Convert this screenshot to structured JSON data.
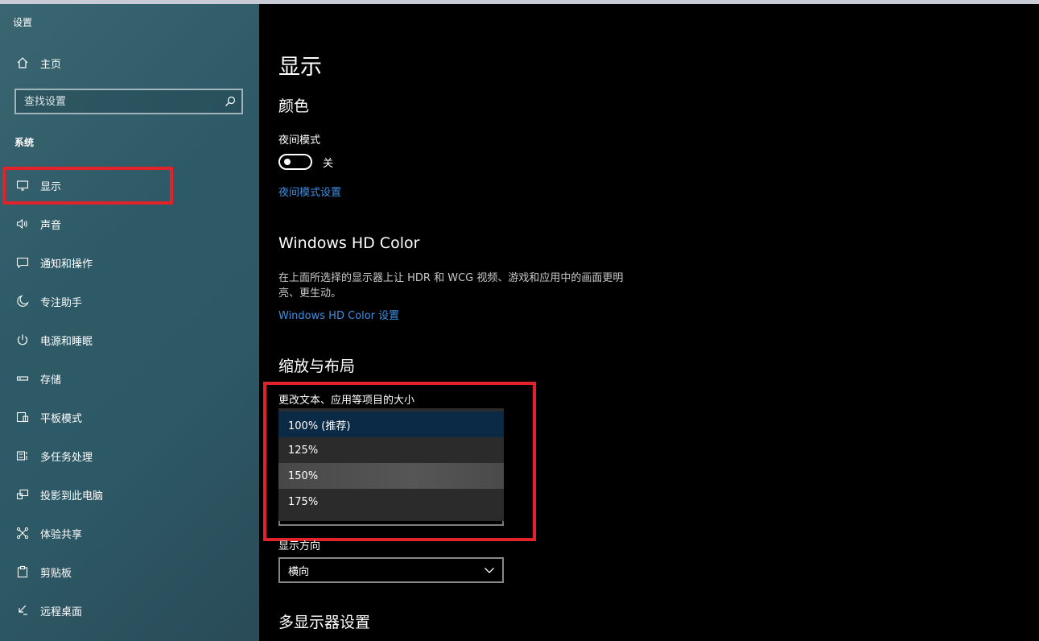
{
  "window": {
    "title": "设置"
  },
  "sidebar": {
    "home_label": "主页",
    "search_placeholder": "查找设置",
    "section_label": "系统",
    "items": [
      {
        "label": "显示",
        "icon": "monitor-icon"
      },
      {
        "label": "声音",
        "icon": "speaker-icon"
      },
      {
        "label": "通知和操作",
        "icon": "notification-icon"
      },
      {
        "label": "专注助手",
        "icon": "moon-icon"
      },
      {
        "label": "电源和睡眠",
        "icon": "power-icon"
      },
      {
        "label": "存储",
        "icon": "storage-icon"
      },
      {
        "label": "平板模式",
        "icon": "tablet-icon"
      },
      {
        "label": "多任务处理",
        "icon": "multitask-icon"
      },
      {
        "label": "投影到此电脑",
        "icon": "projection-icon"
      },
      {
        "label": "体验共享",
        "icon": "share-icon"
      },
      {
        "label": "剪贴板",
        "icon": "clipboard-icon"
      },
      {
        "label": "远程桌面",
        "icon": "remote-desktop-icon"
      }
    ]
  },
  "main": {
    "page_title": "显示",
    "color_heading": "颜色",
    "night_mode_label": "夜间模式",
    "night_mode_state": "关",
    "night_mode_link": "夜间模式设置",
    "hd_color_heading": "Windows HD Color",
    "hd_color_desc": "在上面所选择的显示器上让 HDR 和 WCG 视频、游戏和应用中的画面更明亮、更生动。",
    "hd_color_link": "Windows HD Color 设置",
    "scale_heading": "缩放与布局",
    "scale_label": "更改文本、应用等项目的大小",
    "scale_options": [
      "100% (推荐)",
      "125%",
      "150%",
      "175%"
    ],
    "orientation_label": "显示方向",
    "orientation_value": "横向",
    "multi_display_heading": "多显示器设置"
  },
  "colors": {
    "accent_link": "#3d8fe0",
    "highlight_red": "#e0232a",
    "selected_option": "#0b2a45",
    "hover_option": "#555555"
  }
}
